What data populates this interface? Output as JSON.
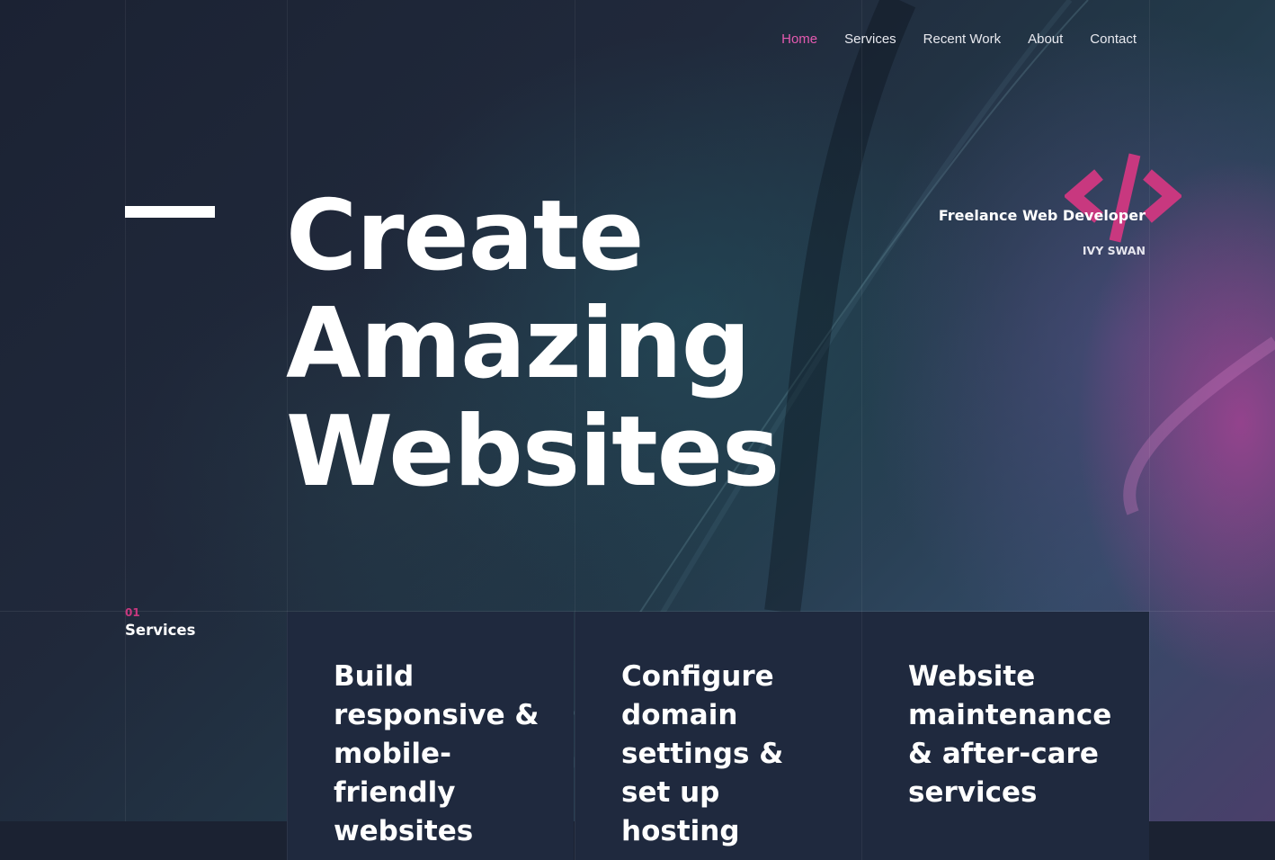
{
  "nav": {
    "items": [
      {
        "label": "Home",
        "active": true
      },
      {
        "label": "Services",
        "active": false
      },
      {
        "label": "Recent Work",
        "active": false
      },
      {
        "label": "About",
        "active": false
      },
      {
        "label": "Contact",
        "active": false
      }
    ]
  },
  "hero": {
    "title_lines": [
      "Create",
      "Amazing",
      "Websites"
    ]
  },
  "brand": {
    "logo_icon": "code-brackets-icon",
    "role": "Freelance Web Developer",
    "name": "IVY SWAN"
  },
  "services": {
    "number": "01",
    "title": "Services",
    "cards": [
      {
        "text": "Build responsive & mobile-friendly websites"
      },
      {
        "text": "Configure domain settings & set up hosting"
      },
      {
        "text": "Website maintenance & after-care services"
      }
    ]
  },
  "colors": {
    "accent": "#e45ab0",
    "accent_dark": "#c8387f",
    "background": "#1b2232",
    "card": "#1f293e"
  }
}
